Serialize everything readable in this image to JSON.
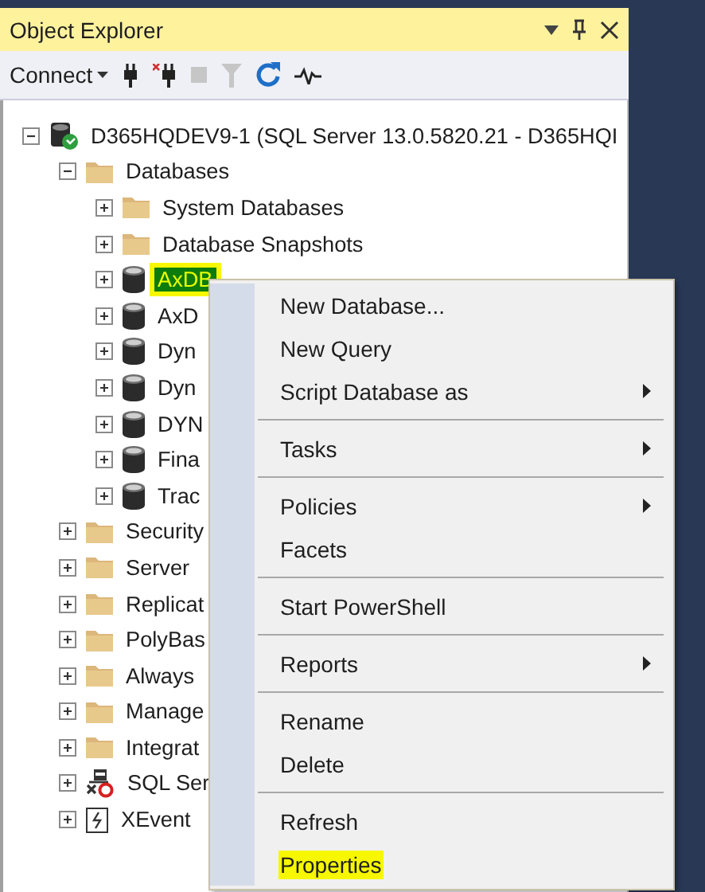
{
  "window": {
    "title": "Object Explorer"
  },
  "toolbar": [
    {
      "kind": "connect",
      "label": "Connect",
      "disabled": false
    },
    {
      "kind": "plug",
      "disabled": false
    },
    {
      "kind": "unplug",
      "disabled": false
    },
    {
      "kind": "stop",
      "disabled": true
    },
    {
      "kind": "filter",
      "disabled": true
    },
    {
      "kind": "refresh",
      "disabled": false
    },
    {
      "kind": "activity",
      "disabled": false
    }
  ],
  "tree": [
    {
      "kind": "server",
      "label": "D365HQDEV9-1 (SQL Server 13.0.5820.21 - D365HQI",
      "expanded": true,
      "selected": false,
      "highlighted": false,
      "children": [
        {
          "kind": "folder",
          "label": "Databases",
          "expanded": true,
          "selected": false,
          "highlighted": false,
          "children": [
            {
              "kind": "folder",
              "label": "System Databases",
              "expanded": false,
              "selected": false,
              "highlighted": false
            },
            {
              "kind": "folder",
              "label": "Database Snapshots",
              "expanded": false,
              "selected": false,
              "highlighted": false
            },
            {
              "kind": "database",
              "label": "AxDB",
              "expanded": false,
              "selected": true,
              "highlighted": true
            },
            {
              "kind": "database",
              "label": "AxD",
              "expanded": false,
              "selected": false,
              "highlighted": false
            },
            {
              "kind": "database",
              "label": "Dyn",
              "expanded": false,
              "selected": false,
              "highlighted": false
            },
            {
              "kind": "database",
              "label": "Dyn",
              "expanded": false,
              "selected": false,
              "highlighted": false
            },
            {
              "kind": "database",
              "label": "DYN",
              "expanded": false,
              "selected": false,
              "highlighted": false
            },
            {
              "kind": "database",
              "label": "Fina",
              "expanded": false,
              "selected": false,
              "highlighted": false
            },
            {
              "kind": "database",
              "label": "Trac",
              "expanded": false,
              "selected": false,
              "highlighted": false
            }
          ]
        },
        {
          "kind": "folder",
          "label": "Security",
          "expanded": false,
          "selected": false,
          "highlighted": false
        },
        {
          "kind": "folder",
          "label": "Server",
          "expanded": false,
          "selected": false,
          "highlighted": false
        },
        {
          "kind": "folder",
          "label": "Replicat",
          "expanded": false,
          "selected": false,
          "highlighted": false
        },
        {
          "kind": "folder",
          "label": "PolyBas",
          "expanded": false,
          "selected": false,
          "highlighted": false
        },
        {
          "kind": "folder",
          "label": "Always",
          "expanded": false,
          "selected": false,
          "highlighted": false
        },
        {
          "kind": "folder",
          "label": "Manage",
          "expanded": false,
          "selected": false,
          "highlighted": false
        },
        {
          "kind": "folder",
          "label": "Integrat",
          "expanded": false,
          "selected": false,
          "highlighted": false
        },
        {
          "kind": "agent",
          "label": "SQL Ser",
          "expanded": false,
          "selected": false,
          "highlighted": false
        },
        {
          "kind": "xevent",
          "label": "XEvent",
          "expanded": false,
          "selected": false,
          "highlighted": false
        }
      ]
    }
  ],
  "context_menu": {
    "groups": [
      [
        {
          "label": "New Database...",
          "submenu": false,
          "highlighted": false
        },
        {
          "label": "New Query",
          "submenu": false,
          "highlighted": false
        },
        {
          "label": "Script Database as",
          "submenu": true,
          "highlighted": false
        }
      ],
      [
        {
          "label": "Tasks",
          "submenu": true,
          "highlighted": false
        }
      ],
      [
        {
          "label": "Policies",
          "submenu": true,
          "highlighted": false
        },
        {
          "label": "Facets",
          "submenu": false,
          "highlighted": false
        }
      ],
      [
        {
          "label": "Start PowerShell",
          "submenu": false,
          "highlighted": false
        }
      ],
      [
        {
          "label": "Reports",
          "submenu": true,
          "highlighted": false
        }
      ],
      [
        {
          "label": "Rename",
          "submenu": false,
          "highlighted": false
        },
        {
          "label": "Delete",
          "submenu": false,
          "highlighted": false
        }
      ],
      [
        {
          "label": "Refresh",
          "submenu": false,
          "highlighted": false
        },
        {
          "label": "Properties",
          "submenu": false,
          "highlighted": true
        }
      ]
    ]
  }
}
